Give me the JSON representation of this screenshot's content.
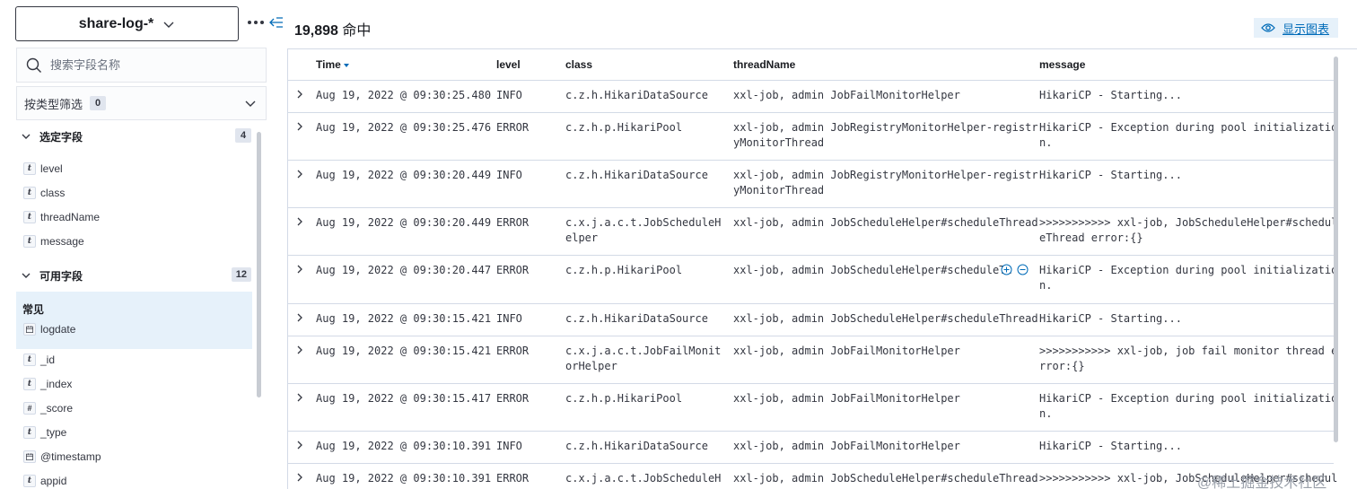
{
  "sidebar": {
    "index_pattern": "share-log-*",
    "search_placeholder": "搜索字段名称",
    "filter_by_type": {
      "label": "按类型筛选",
      "count": "0"
    },
    "selected": {
      "label": "选定字段",
      "count": "4",
      "fields": [
        {
          "type": "t",
          "name": "level"
        },
        {
          "type": "t",
          "name": "class"
        },
        {
          "type": "t",
          "name": "threadName"
        },
        {
          "type": "t",
          "name": "message"
        }
      ]
    },
    "available": {
      "label": "可用字段",
      "count": "12",
      "common_label": "常见",
      "common_fields": [
        {
          "type": "date",
          "name": "logdate"
        }
      ],
      "fields": [
        {
          "type": "t",
          "name": "_id"
        },
        {
          "type": "t",
          "name": "_index"
        },
        {
          "type": "#",
          "name": "_score"
        },
        {
          "type": "t",
          "name": "_type"
        },
        {
          "type": "date",
          "name": "@timestamp"
        },
        {
          "type": "t",
          "name": "appid"
        }
      ]
    }
  },
  "main": {
    "hits_count": "19,898",
    "hits_label": "命中",
    "show_chart_label": "显示图表",
    "columns": [
      "Time",
      "level",
      "class",
      "threadName",
      "message"
    ],
    "rows": [
      {
        "time": "Aug 19, 2022 @ 09:30:25.480",
        "level": "INFO",
        "class": "c.z.h.HikariDataSource",
        "thread": "xxl-job, admin JobFailMonitorHelper",
        "message": "HikariCP - Starting..."
      },
      {
        "time": "Aug 19, 2022 @ 09:30:25.476",
        "level": "ERROR",
        "class": "c.z.h.p.HikariPool",
        "thread": "xxl-job, admin JobRegistryMonitorHelper-registr\nyMonitorThread",
        "message": "HikariCP - Exception during pool initializatio\nn."
      },
      {
        "time": "Aug 19, 2022 @ 09:30:20.449",
        "level": "INFO",
        "class": "c.z.h.HikariDataSource",
        "thread": "xxl-job, admin JobRegistryMonitorHelper-registr\nyMonitorThread",
        "message": "HikariCP - Starting..."
      },
      {
        "time": "Aug 19, 2022 @ 09:30:20.449",
        "level": "ERROR",
        "class": "c.x.j.a.c.t.JobScheduleH\nelper",
        "thread": "xxl-job, admin JobScheduleHelper#scheduleThread",
        "message": ">>>>>>>>>>> xxl-job, JobScheduleHelper#schedul\neThread error:{}"
      },
      {
        "time": "Aug 19, 2022 @ 09:30:20.447",
        "level": "ERROR",
        "class": "c.z.h.p.HikariPool",
        "thread": "xxl-job, admin JobScheduleHelper#scheduleTh",
        "message": "HikariCP - Exception during pool initializatio\nn."
      },
      {
        "time": "Aug 19, 2022 @ 09:30:15.421",
        "level": "INFO",
        "class": "c.z.h.HikariDataSource",
        "thread": "xxl-job, admin JobScheduleHelper#scheduleThread",
        "message": "HikariCP - Starting..."
      },
      {
        "time": "Aug 19, 2022 @ 09:30:15.421",
        "level": "ERROR",
        "class": "c.x.j.a.c.t.JobFailMonit\norHelper",
        "thread": "xxl-job, admin JobFailMonitorHelper",
        "message": ">>>>>>>>>>> xxl-job, job fail monitor thread e\nrror:{}"
      },
      {
        "time": "Aug 19, 2022 @ 09:30:15.417",
        "level": "ERROR",
        "class": "c.z.h.p.HikariPool",
        "thread": "xxl-job, admin JobFailMonitorHelper",
        "message": "HikariCP - Exception during pool initializatio\nn."
      },
      {
        "time": "Aug 19, 2022 @ 09:30:10.391",
        "level": "INFO",
        "class": "c.z.h.HikariDataSource",
        "thread": "xxl-job, admin JobFailMonitorHelper",
        "message": "HikariCP - Starting..."
      },
      {
        "time": "Aug 19, 2022 @ 09:30:10.391",
        "level": "ERROR",
        "class": "c.x.j.a.c.t.JobScheduleH",
        "thread": "xxl-job, admin JobScheduleHelper#scheduleThread",
        "message": ">>>>>>>>>>> xxl-job, JobScheduleHelper#schedul"
      }
    ]
  },
  "watermark": "@稀土掘金技术社区",
  "colors": {
    "accent": "#006bb8",
    "highlight": "#e6f1fa",
    "border": "#d3dae6"
  }
}
